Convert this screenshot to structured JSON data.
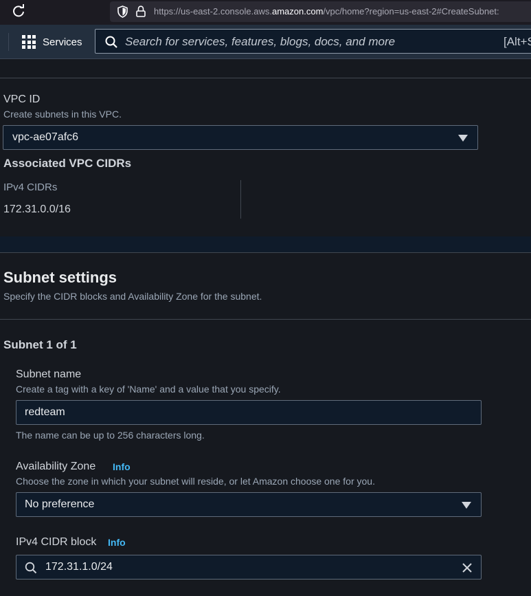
{
  "browser": {
    "url_prefix": "https://us-east-2.console.aws.",
    "url_domain": "amazon.com",
    "url_suffix": "/vpc/home?region=us-east-2#CreateSubnet:"
  },
  "nav": {
    "services_label": "Services",
    "search_placeholder": "Search for services, features, blogs, docs, and more",
    "search_shortcut": "[Alt+S]"
  },
  "vpc": {
    "label": "VPC ID",
    "description": "Create subnets in this VPC.",
    "selected": "vpc-ae07afc6",
    "cidrs_heading": "Associated VPC CIDRs",
    "ipv4_label": "IPv4 CIDRs",
    "ipv4_value": "172.31.0.0/16"
  },
  "subnet_settings": {
    "title": "Subnet settings",
    "description": "Specify the CIDR blocks and Availability Zone for the subnet.",
    "subnet_heading": "Subnet 1 of 1",
    "name_label": "Subnet name",
    "name_description": "Create a tag with a key of 'Name' and a value that you specify.",
    "name_value": "redteam",
    "name_hint": "The name can be up to 256 characters long.",
    "az_label": "Availability Zone",
    "az_info": "Info",
    "az_description": "Choose the zone in which your subnet will reside, or let Amazon choose one for you.",
    "az_selected": "No preference",
    "cidr_label": "IPv4 CIDR block",
    "cidr_info": "Info",
    "cidr_value": "172.31.1.0/24"
  }
}
